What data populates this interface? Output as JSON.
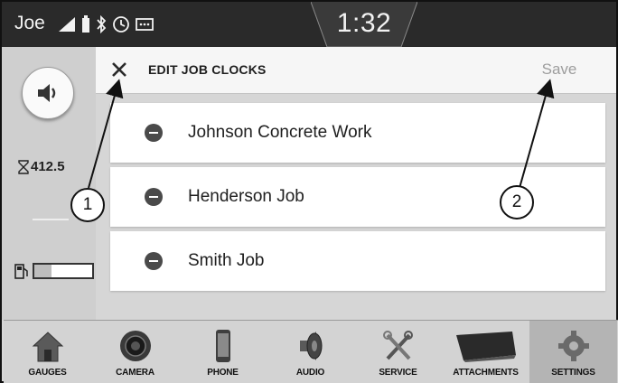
{
  "status_bar": {
    "user": "Joe",
    "time": "1:32",
    "icons": [
      "signal-icon",
      "battery-icon",
      "bluetooth-icon",
      "gps-icon",
      "message-icon"
    ]
  },
  "left_panel": {
    "volume_icon": "speaker-icon",
    "hours_value": "412.5",
    "hours_icon": "hourglass-icon",
    "fuel_icon": "fuel-pump-icon",
    "fuel_level": 0.3
  },
  "header": {
    "close_icon": "close-icon",
    "title": "EDIT JOB CLOCKS",
    "save_label": "Save"
  },
  "jobs": [
    {
      "name": "Johnson Concrete Work"
    },
    {
      "name": "Henderson Job"
    },
    {
      "name": "Smith Job"
    }
  ],
  "callouts": [
    {
      "label": "1"
    },
    {
      "label": "2"
    }
  ],
  "bottom_nav": [
    {
      "label": "GAUGES",
      "icon": "house-icon",
      "active": false
    },
    {
      "label": "CAMERA",
      "icon": "camera-icon",
      "active": false
    },
    {
      "label": "PHONE",
      "icon": "phone-icon",
      "active": false
    },
    {
      "label": "AUDIO",
      "icon": "speaker-icon",
      "active": false
    },
    {
      "label": "SERVICE",
      "icon": "tools-icon",
      "active": false
    },
    {
      "label": "ATTACHMENTS",
      "icon": "bucket-icon",
      "active": false
    },
    {
      "label": "SETTINGS",
      "icon": "gear-icon",
      "active": true
    }
  ],
  "colors": {
    "status_bar": "#2a2a2a",
    "screen_bg": "#d6d6d6",
    "active_tab": "#b4b4b4",
    "save_disabled": "#9d9d9d"
  }
}
